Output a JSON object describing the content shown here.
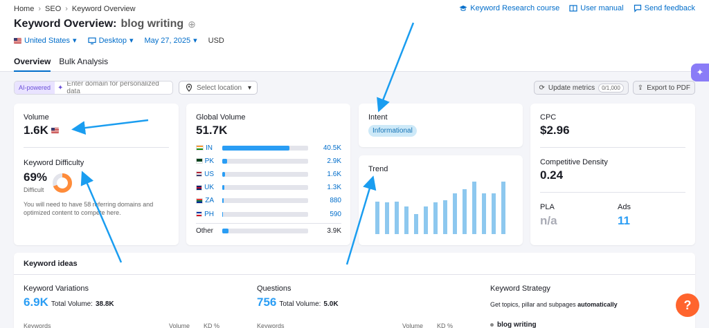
{
  "breadcrumb": [
    "Home",
    "SEO",
    "Keyword Overview"
  ],
  "top_links": [
    "Keyword Research course",
    "User manual",
    "Send feedback"
  ],
  "title": {
    "prefix": "Keyword Overview:",
    "keyword": "blog writing"
  },
  "filters": {
    "country": "United States",
    "device": "Desktop",
    "date": "May 27, 2025",
    "currency": "USD"
  },
  "tabs": [
    "Overview",
    "Bulk Analysis"
  ],
  "toolbar": {
    "ai_badge": "AI-powered",
    "domain_placeholder": "Enter domain for personalized data",
    "location_placeholder": "Select location",
    "update_label": "Update metrics",
    "update_count": "0/1,000",
    "export_label": "Export to PDF"
  },
  "volume": {
    "label": "Volume",
    "value": "1.6K"
  },
  "difficulty": {
    "label": "Keyword Difficulty",
    "value": "69%",
    "level": "Difficult",
    "percent": 69,
    "note": "You will need to have 58 referring domains and optimized content to compete here."
  },
  "global_volume": {
    "label": "Global Volume",
    "value": "51.7K",
    "rows": [
      {
        "code": "IN",
        "value": "40.5K",
        "fraction": 0.78,
        "flag": [
          "#ff9933",
          "#ffffff",
          "#138808"
        ]
      },
      {
        "code": "PK",
        "value": "2.9K",
        "fraction": 0.06,
        "flag": [
          "#01411c",
          "#01411c",
          "#ffffff"
        ]
      },
      {
        "code": "US",
        "value": "1.6K",
        "fraction": 0.03,
        "flag": [
          "#b22234",
          "#ffffff",
          "#3c3b6e"
        ]
      },
      {
        "code": "UK",
        "value": "1.3K",
        "fraction": 0.025,
        "flag": [
          "#012169",
          "#c8102e",
          "#012169"
        ]
      },
      {
        "code": "ZA",
        "value": "880",
        "fraction": 0.018,
        "flag": [
          "#de3831",
          "#007a4d",
          "#002395"
        ]
      },
      {
        "code": "PH",
        "value": "590",
        "fraction": 0.012,
        "flag": [
          "#0038a8",
          "#ffffff",
          "#ce1126"
        ]
      }
    ],
    "other": {
      "label": "Other",
      "value": "3.9K",
      "fraction": 0.075
    }
  },
  "intent": {
    "label": "Intent",
    "value": "Informational"
  },
  "trend": {
    "label": "Trend",
    "values": [
      0.62,
      0.6,
      0.62,
      0.52,
      0.38,
      0.52,
      0.6,
      0.65,
      0.78,
      0.85,
      1.0,
      0.78,
      0.78,
      1.0
    ]
  },
  "cpc": {
    "label": "CPC",
    "value": "$2.96"
  },
  "competitive_density": {
    "label": "Competitive Density",
    "value": "0.24"
  },
  "pla": {
    "label": "PLA",
    "value": "n/a"
  },
  "ads": {
    "label": "Ads",
    "value": "11"
  },
  "keyword_ideas": {
    "title": "Keyword ideas",
    "variations": {
      "label": "Keyword Variations",
      "value": "6.9K",
      "total_label": "Total Volume:",
      "total": "38.8K"
    },
    "questions": {
      "label": "Questions",
      "value": "756",
      "total_label": "Total Volume:",
      "total": "5.0K"
    },
    "strategy": {
      "label": "Keyword Strategy",
      "desc": "Get topics, pillar and subpages",
      "desc_bold": "automatically",
      "item": "blog writing"
    },
    "col_keywords": "Keywords",
    "col_volume": "Volume",
    "col_kd": "KD %"
  },
  "colors": {
    "accent": "#006dca",
    "bar": "#2a9df4",
    "trend": "#8dc8ef",
    "donut": "#ff8c3a",
    "help": "#ff642d",
    "arrow": "#1a9df0"
  }
}
